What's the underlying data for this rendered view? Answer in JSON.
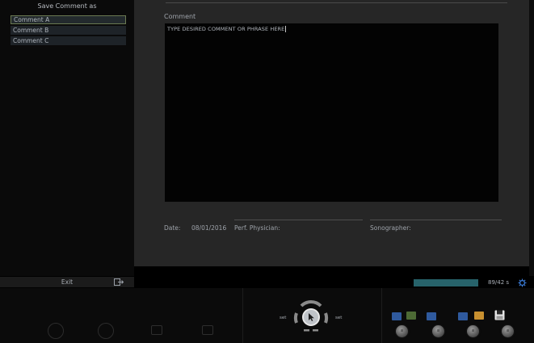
{
  "left_panel": {
    "title": "Save Comment as",
    "items": [
      {
        "label": "Comment A",
        "selected": true
      },
      {
        "label": "Comment B",
        "selected": false
      },
      {
        "label": "Comment C",
        "selected": false
      }
    ],
    "exit_label": "Exit",
    "exit_icon": "exit-door-icon"
  },
  "main": {
    "comment_label": "Comment",
    "comment_text": "TYPE DESIRED COMMENT OR PHRASE HERE",
    "date_label": "Date:",
    "date_value": "08/01/2016",
    "perf_physician_label": "Perf. Physician:",
    "sonographer_label": "Sonographer:"
  },
  "status": {
    "progress_text": "89/42 s",
    "settings_icon": "gear-icon",
    "accent_color": "#27636b"
  },
  "bottom_bar": {
    "set_left": "set",
    "set_right": "set",
    "center_icon": "cursor-icon",
    "knobs": [
      {
        "label": "≡"
      },
      {
        "label": "≡"
      },
      {
        "label": "≡"
      },
      {
        "label": "≡"
      }
    ]
  }
}
